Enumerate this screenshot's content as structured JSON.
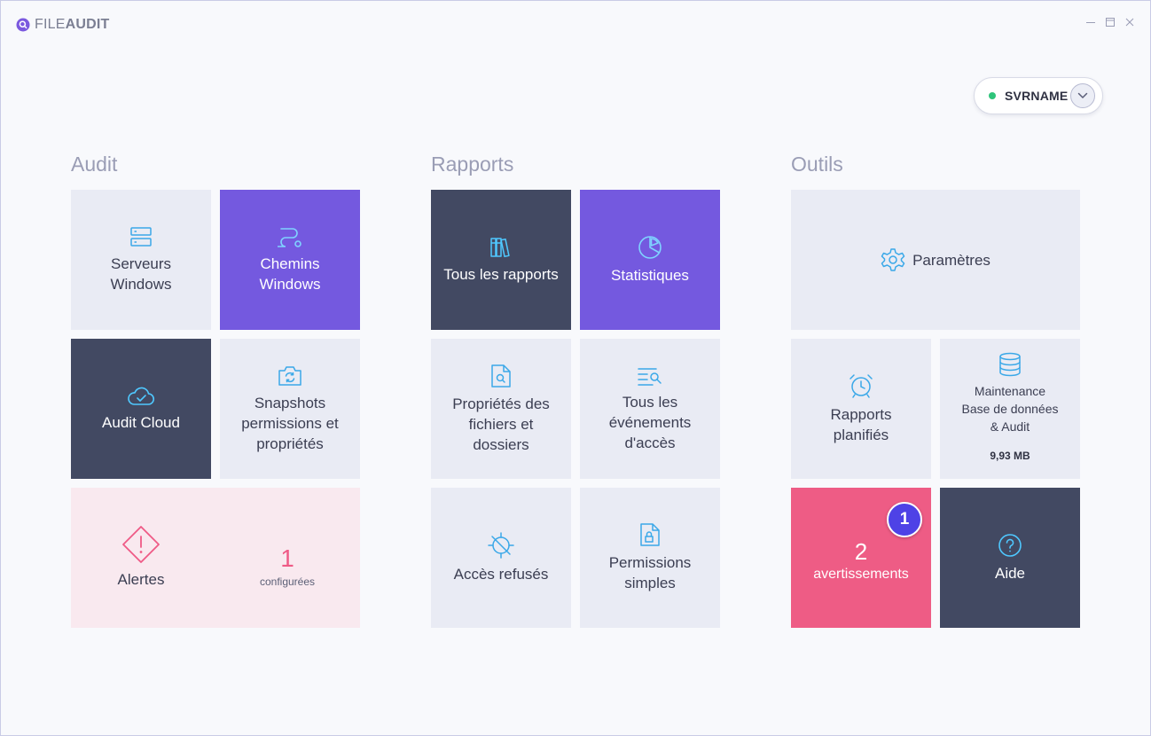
{
  "app": {
    "brand_light": "FILE",
    "brand_bold": "AUDIT"
  },
  "server": {
    "name": "SVRNAME",
    "status_color": "#2ec47a"
  },
  "sections": {
    "audit": "Audit",
    "reports": "Rapports",
    "tools": "Outils"
  },
  "audit": {
    "servers_windows": "Serveurs\nWindows",
    "paths_windows": "Chemins\nWindows",
    "audit_cloud": "Audit Cloud",
    "snapshots": "Snapshots\npermissions et\npropriétés",
    "alerts": {
      "label": "Alertes",
      "count": "1",
      "count_label": "configurées"
    }
  },
  "reports": {
    "all_reports": "Tous les rapports",
    "statistics": "Statistiques",
    "file_properties": "Propriétés des\nfichiers et\ndossiers",
    "all_events": "Tous les\névénements\nd'accès",
    "access_denied": "Accès refusés",
    "simple_permissions": "Permissions\nsimples"
  },
  "tools": {
    "settings": "Paramètres",
    "scheduled_reports": "Rapports\nplanifiés",
    "maintenance": {
      "label": "Maintenance\nBase de données\n& Audit",
      "size": "9,93 MB"
    },
    "warnings": {
      "count": "2",
      "label": "avertissements",
      "badge": "1"
    },
    "help": "Aide"
  },
  "colors": {
    "purple": "#7459df",
    "dark": "#424962",
    "light": "#e9ebf4",
    "alert_bg": "#f9e9ef",
    "warning": "#ee5c85",
    "badge": "#4e42e6",
    "icon_blue": "#3aa8e8"
  }
}
